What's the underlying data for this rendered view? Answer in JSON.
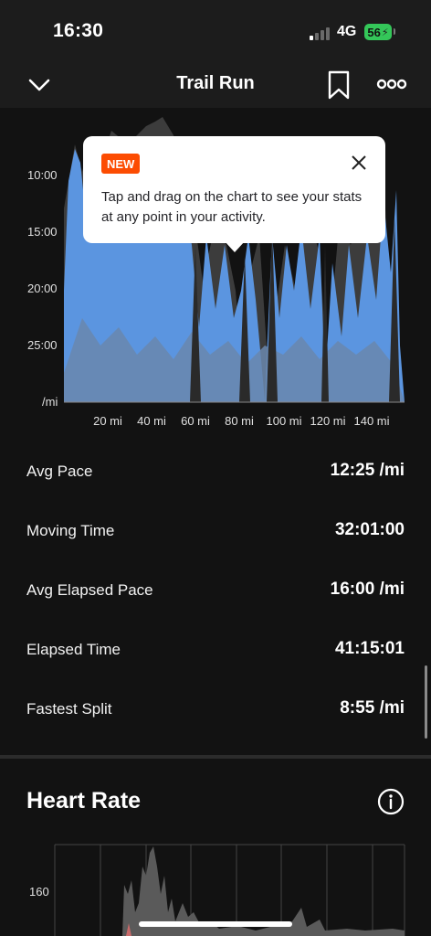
{
  "status_bar": {
    "time": "16:30",
    "network": "4G",
    "battery": "56",
    "signal_bars_active": 1,
    "signal_bars_total": 4
  },
  "nav": {
    "title": "Trail Run",
    "back_icon": "chevron-down-icon",
    "bookmark_icon": "bookmark-icon",
    "more_icon": "more-icon"
  },
  "pace_chart": {
    "y_labels": [
      "10:00",
      "15:00",
      "20:00",
      "25:00",
      "/mi"
    ],
    "x_labels": [
      "20 mi",
      "40 mi",
      "60 mi",
      "80 mi",
      "100 mi",
      "120 mi",
      "140 mi"
    ]
  },
  "tooltip": {
    "badge": "NEW",
    "text": "Tap and drag on the chart to see your stats at any point in your activity.",
    "close_icon": "close-icon"
  },
  "stats": [
    {
      "label": "Avg Pace",
      "value": "12:25 /mi"
    },
    {
      "label": "Moving Time",
      "value": "32:01:00"
    },
    {
      "label": "Avg Elapsed Pace",
      "value": "16:00 /mi"
    },
    {
      "label": "Elapsed Time",
      "value": "41:15:01"
    },
    {
      "label": "Fastest Split",
      "value": "8:55 /mi"
    }
  ],
  "heart_rate": {
    "title": "Heart Rate",
    "y_label": "160",
    "info_icon": "info-icon"
  },
  "colors": {
    "background": "#121212",
    "pace_blue": "#5b95e0",
    "pace_muted": "#6a87ad",
    "elapsed_dark": "#3a3a3a",
    "accent": "#fc4c02",
    "battery_green": "#34c759"
  }
}
